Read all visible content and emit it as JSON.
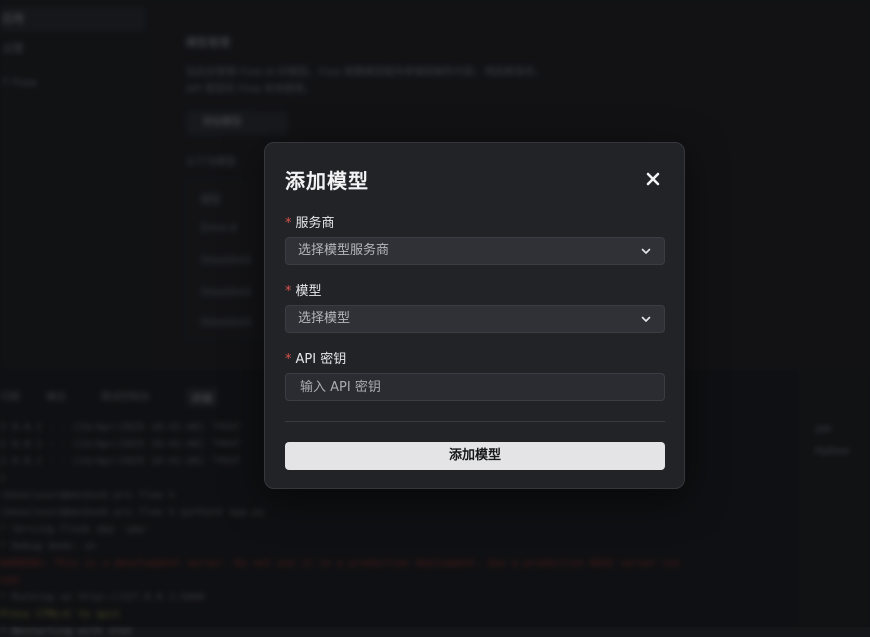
{
  "background": {
    "sidebar_items": [
      "应用",
      "设置",
      "T Flow"
    ],
    "section_title": "模型管理",
    "description_lines": [
      "在此处管理 Flow AI 的模型。Flow 需要模型服务来辅助解析内容，将结果保存。",
      "API 密钥仅 Flow 本地使用。"
    ],
    "add_button": "添加模型",
    "table_caption": "以下为模型",
    "table_rows": [
      "模型",
      "Ernie-4",
      "DeepSeek",
      "DeepSeek",
      "DeepSeek"
    ],
    "terminal_tabs": [
      "问题",
      "输出",
      "调试控制台",
      "终端"
    ],
    "terminal_lines": [
      {
        "text": "2 0.0.1 - - [14/Apr/2025 10:41:40] \"POST",
        "color": "#8a8c92"
      },
      {
        "text": "2 0.0.1 - - [14/Apr/2025 10:41:40] \"POST",
        "color": "#8a8c92"
      },
      {
        "text": "2 0.0.1 - - [14/Apr/2025 10:41:40] \"POST",
        "color": "#8a8c92"
      },
      {
        "text": "t",
        "color": "#8a8c92"
      },
      {
        "text": "(base)user@macbook-pro flow % ",
        "color": "#8a8c92"
      },
      {
        "text": "(base)user@macbook-pro flow % python3 app.py",
        "color": "#8a8c92"
      },
      {
        "text": "* Serving Flask app 'app'",
        "color": "#8a8c92"
      },
      {
        "text": "* Debug mode: on",
        "color": "#8a8c92"
      },
      {
        "text": "WARNING: This is a development server. Do not use it in a production deployment. Use a production WSGI server ins",
        "color": "#c0392b"
      },
      {
        "text": "ead.",
        "color": "#c0392b"
      },
      {
        "text": "* Running on http://127.0.0.1:5000",
        "color": "#8a8c92"
      },
      {
        "text": "Press CTRL+C to quit",
        "color": "#c4c44a"
      },
      {
        "text": "* Restarting with stat",
        "color": "#8a8c92"
      }
    ],
    "right_panel_items": [
      "zsh",
      "Python"
    ]
  },
  "modal": {
    "title": "添加模型",
    "fields": {
      "provider": {
        "label": "服务商",
        "placeholder": "选择模型服务商"
      },
      "model": {
        "label": "模型",
        "placeholder": "选择模型"
      },
      "api_key": {
        "label": "API 密钥",
        "placeholder": "输入 API 密钥"
      }
    },
    "required_mark": "*",
    "submit_label": "添加模型"
  },
  "colors": {
    "accent_required": "#d9534f",
    "submit_bg": "#e4e4e7",
    "modal_bg": "#222327"
  }
}
